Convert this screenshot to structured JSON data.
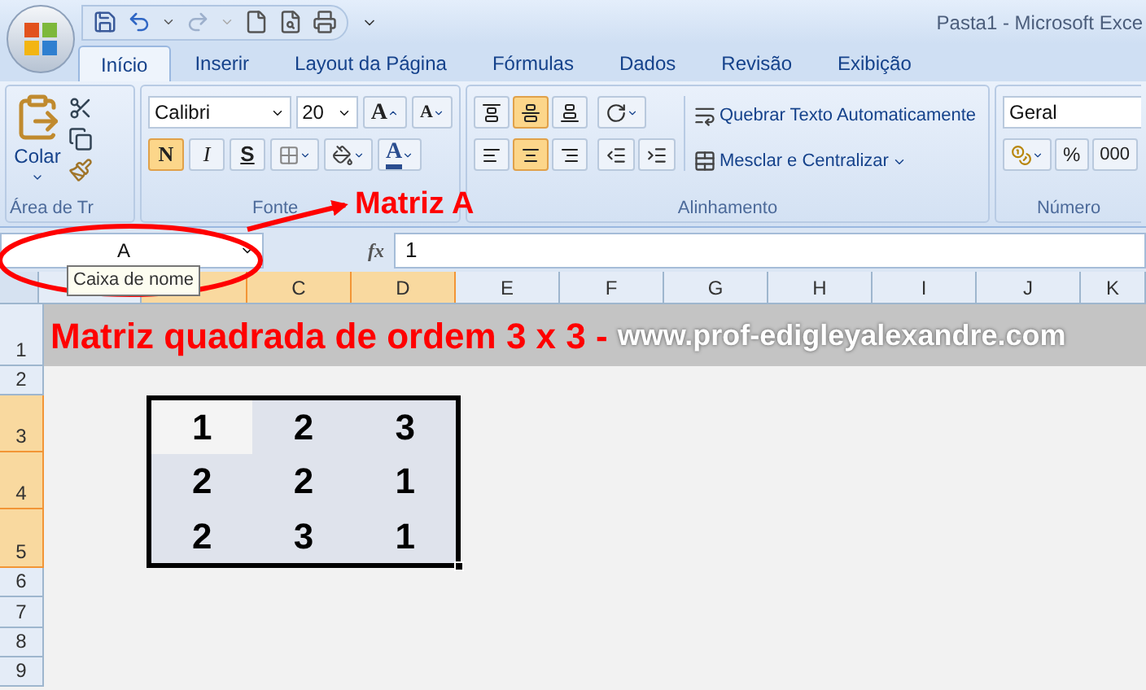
{
  "window": {
    "title": "Pasta1 - Microsoft Exce"
  },
  "tabs": [
    {
      "label": "Início",
      "selected": true
    },
    {
      "label": "Inserir",
      "selected": false
    },
    {
      "label": "Layout da Página",
      "selected": false
    },
    {
      "label": "Fórmulas",
      "selected": false
    },
    {
      "label": "Dados",
      "selected": false
    },
    {
      "label": "Revisão",
      "selected": false
    },
    {
      "label": "Exibição",
      "selected": false
    }
  ],
  "clipboard": {
    "label": "Área de Tr",
    "paste": "Colar"
  },
  "font": {
    "label": "Fonte",
    "name": "Calibri",
    "size": "20",
    "grow": "A",
    "shrink": "A",
    "color_letter": "A",
    "styles": [
      {
        "letter": "N",
        "kind": "bold",
        "selected": true
      },
      {
        "letter": "I",
        "kind": "italic",
        "selected": false
      },
      {
        "letter": "S",
        "kind": "underline",
        "selected": false
      }
    ]
  },
  "alignment": {
    "label": "Alinhamento",
    "wrap": "Quebrar Texto Automaticamente",
    "merge": "Mesclar e Centralizar",
    "vertical": [
      {
        "selected": false
      },
      {
        "selected": true
      },
      {
        "selected": false
      }
    ],
    "horizontal": [
      {
        "selected": false
      },
      {
        "selected": true
      },
      {
        "selected": false
      }
    ]
  },
  "number": {
    "label": "Número",
    "format": "Geral",
    "percent": "%",
    "thousands": "000"
  },
  "name_box": {
    "value": "A",
    "tooltip": "Caixa de nome"
  },
  "formula_bar": {
    "fx": "fx",
    "value": "1"
  },
  "columns": [
    {
      "selected": false
    },
    {
      "selected": true
    },
    {
      "label": "C",
      "selected": true
    },
    {
      "label": "D",
      "selected": true
    },
    {
      "label": "E",
      "selected": false
    },
    {
      "label": "F",
      "selected": false
    },
    {
      "label": "G",
      "selected": false
    },
    {
      "label": "H",
      "selected": false
    },
    {
      "label": "I",
      "selected": false
    },
    {
      "label": "J",
      "selected": false
    },
    {
      "label": "K",
      "selected": false
    }
  ],
  "rows": [
    {
      "label": "1",
      "selected": false
    },
    {
      "label": "2",
      "selected": false
    },
    {
      "label": "3",
      "selected": true
    },
    {
      "label": "4",
      "selected": true
    },
    {
      "label": "5",
      "selected": true
    },
    {
      "label": "6",
      "selected": false
    },
    {
      "label": "7",
      "selected": false
    },
    {
      "label": "8",
      "selected": false
    },
    {
      "label": "9",
      "selected": false
    }
  ],
  "title_row": {
    "text": "Matriz quadrada de ordem 3 x 3 -",
    "site": "www.prof-edigleyalexandre.com"
  },
  "matrix": [
    [
      {
        "value": "1",
        "active": true
      },
      {
        "value": "2",
        "active": false
      },
      {
        "value": "3",
        "active": false
      }
    ],
    [
      {
        "value": "2",
        "active": false
      },
      {
        "value": "2",
        "active": false
      },
      {
        "value": "1",
        "active": false
      }
    ],
    [
      {
        "value": "2",
        "active": false
      },
      {
        "value": "3",
        "active": false
      },
      {
        "value": "1",
        "active": false
      }
    ]
  ],
  "annotation": {
    "label": "Matriz A"
  }
}
